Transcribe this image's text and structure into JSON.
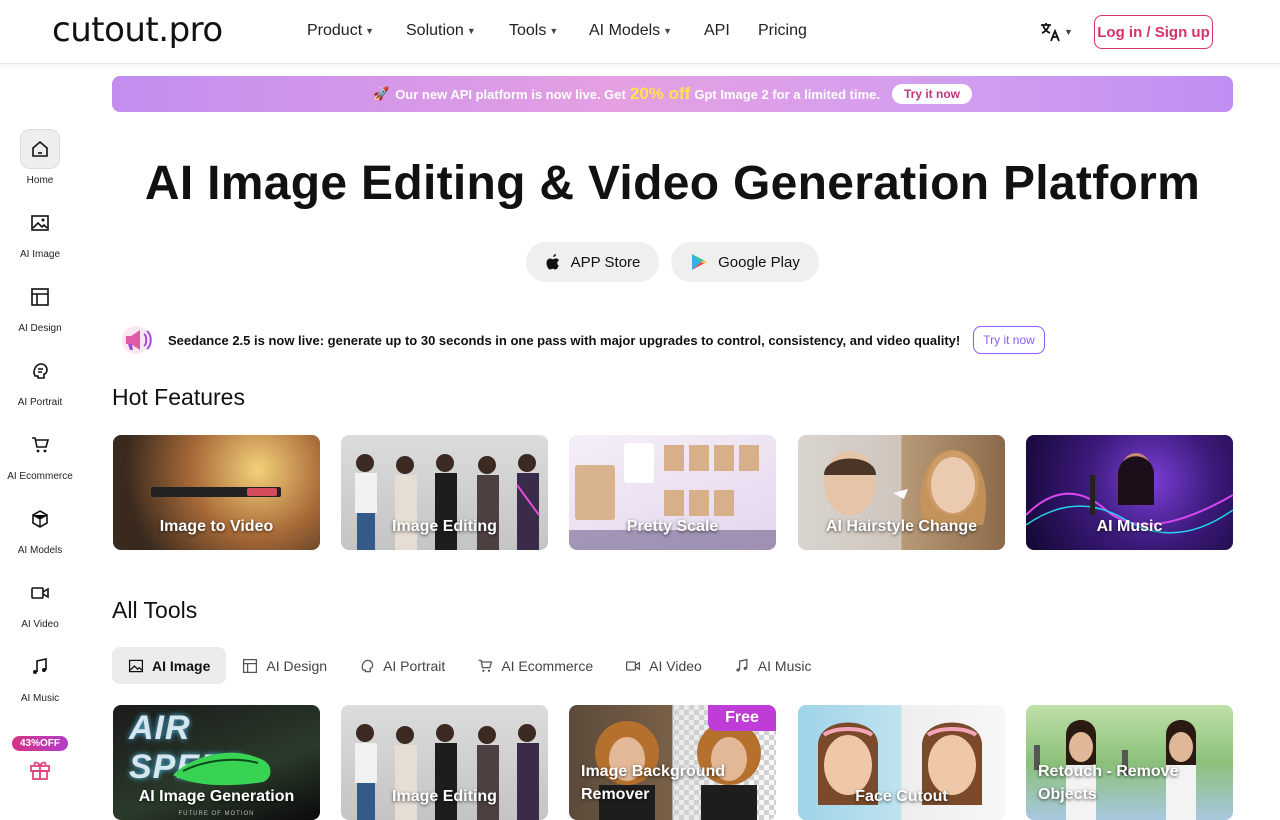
{
  "header": {
    "logo": "cutout.pro",
    "nav": [
      {
        "label": "Product",
        "chevron": true
      },
      {
        "label": "Solution",
        "chevron": true
      },
      {
        "label": "Tools",
        "chevron": true
      },
      {
        "label": "AI Models",
        "chevron": true
      },
      {
        "label": "API",
        "chevron": false
      },
      {
        "label": "Pricing",
        "chevron": false
      }
    ],
    "language_icon": "translate-icon",
    "login_label": "Log in / Sign up"
  },
  "sidebar": {
    "items": [
      {
        "label": "Home",
        "icon": "home-icon",
        "active": true
      },
      {
        "label": "AI Image",
        "icon": "image-icon"
      },
      {
        "label": "AI Design",
        "icon": "layout-icon"
      },
      {
        "label": "AI Portrait",
        "icon": "portrait-icon"
      },
      {
        "label": "AI Ecommerce",
        "icon": "cart-icon"
      },
      {
        "label": "AI Models",
        "icon": "cube-icon"
      },
      {
        "label": "AI Video",
        "icon": "video-icon"
      },
      {
        "label": "AI Music",
        "icon": "music-icon"
      }
    ],
    "promo_badge": "43%OFF",
    "promo_icon": "gift-icon"
  },
  "banner": {
    "prefix": "Our new API platform is now live. Get",
    "highlight": "20% off",
    "suffix": "Gpt Image 2 for a limited time.",
    "button": "Try it now",
    "icon": "rocket-icon"
  },
  "hero": {
    "title": "AI Image Editing & Video Generation Platform",
    "app_store": "APP Store",
    "google_play": "Google Play"
  },
  "announcement": {
    "text": "Seedance 2.5 is now live: generate up to 30 seconds in one pass with major upgrades to control, consistency, and video quality!",
    "button": "Try it now",
    "icon": "megaphone-icon"
  },
  "hot_features": {
    "title": "Hot Features",
    "cards": [
      {
        "label": "Image to Video"
      },
      {
        "label": "Image Editing"
      },
      {
        "label": "Pretty Scale"
      },
      {
        "label": "AI Hairstyle Change"
      },
      {
        "label": "AI Music"
      }
    ]
  },
  "all_tools": {
    "title": "All Tools",
    "tabs": [
      {
        "label": "AI Image",
        "icon": "image-icon",
        "active": true
      },
      {
        "label": "AI Design",
        "icon": "layout-icon"
      },
      {
        "label": "AI Portrait",
        "icon": "portrait-icon"
      },
      {
        "label": "AI Ecommerce",
        "icon": "cart-icon"
      },
      {
        "label": "AI Video",
        "icon": "video-icon"
      },
      {
        "label": "AI Music",
        "icon": "music-icon"
      }
    ],
    "cards": [
      {
        "label": "AI Image Generation",
        "art_text": "AIR SPEED",
        "art_subtext": "FUTURE OF MOTION"
      },
      {
        "label": "Image Editing"
      },
      {
        "label_line1": "Image Background",
        "label_line2": "Remover",
        "badge": "Free"
      },
      {
        "label": "Face Cutout"
      },
      {
        "label_line1": "Retouch - Remove",
        "label_line2": "Objects"
      }
    ]
  },
  "colors": {
    "brand_pink": "#d6336c",
    "banner_purple": "#c38df0",
    "accent_violet": "#8b5cf6",
    "highlight_yellow": "#ffe34d"
  }
}
